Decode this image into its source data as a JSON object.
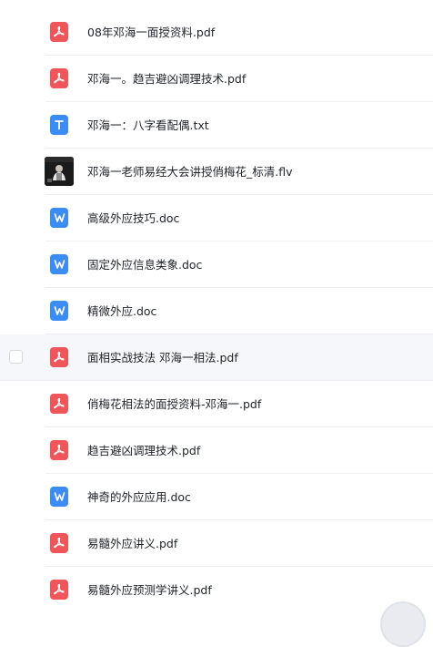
{
  "files": [
    {
      "name": "08年邓海一面授资料.pdf",
      "type": "pdf",
      "icon": "pdf-icon"
    },
    {
      "name": "邓海一。趋吉避凶调理技术.pdf",
      "type": "pdf",
      "icon": "pdf-icon"
    },
    {
      "name": "邓海一：八字看配偶.txt",
      "type": "txt",
      "icon": "txt-icon"
    },
    {
      "name": "邓海一老师易经大会讲授俏梅花_标清.flv",
      "type": "video",
      "icon": "video-thumbnail"
    },
    {
      "name": "高级外应技巧.doc",
      "type": "doc",
      "icon": "word-icon"
    },
    {
      "name": "固定外应信息类象.doc",
      "type": "doc",
      "icon": "word-icon"
    },
    {
      "name": "精微外应.doc",
      "type": "doc",
      "icon": "word-icon"
    },
    {
      "name": "面相实战技法 邓海一相法.pdf",
      "type": "pdf",
      "icon": "pdf-icon",
      "hovered": true
    },
    {
      "name": "俏梅花相法的面授资料-邓海一.pdf",
      "type": "pdf",
      "icon": "pdf-icon"
    },
    {
      "name": "趋吉避凶调理技术.pdf",
      "type": "pdf",
      "icon": "pdf-icon"
    },
    {
      "name": "神奇的外应应用.doc",
      "type": "doc",
      "icon": "word-icon"
    },
    {
      "name": "易髓外应讲义.pdf",
      "type": "pdf",
      "icon": "pdf-icon"
    },
    {
      "name": "易髓外应预测学讲义.pdf",
      "type": "pdf",
      "icon": "pdf-icon"
    }
  ],
  "colors": {
    "pdf": "#f0555a",
    "doc": "#3b8cf5",
    "txt": "#3b8cf5",
    "hover_bg": "#f6f7fa",
    "text": "#1f2329"
  }
}
